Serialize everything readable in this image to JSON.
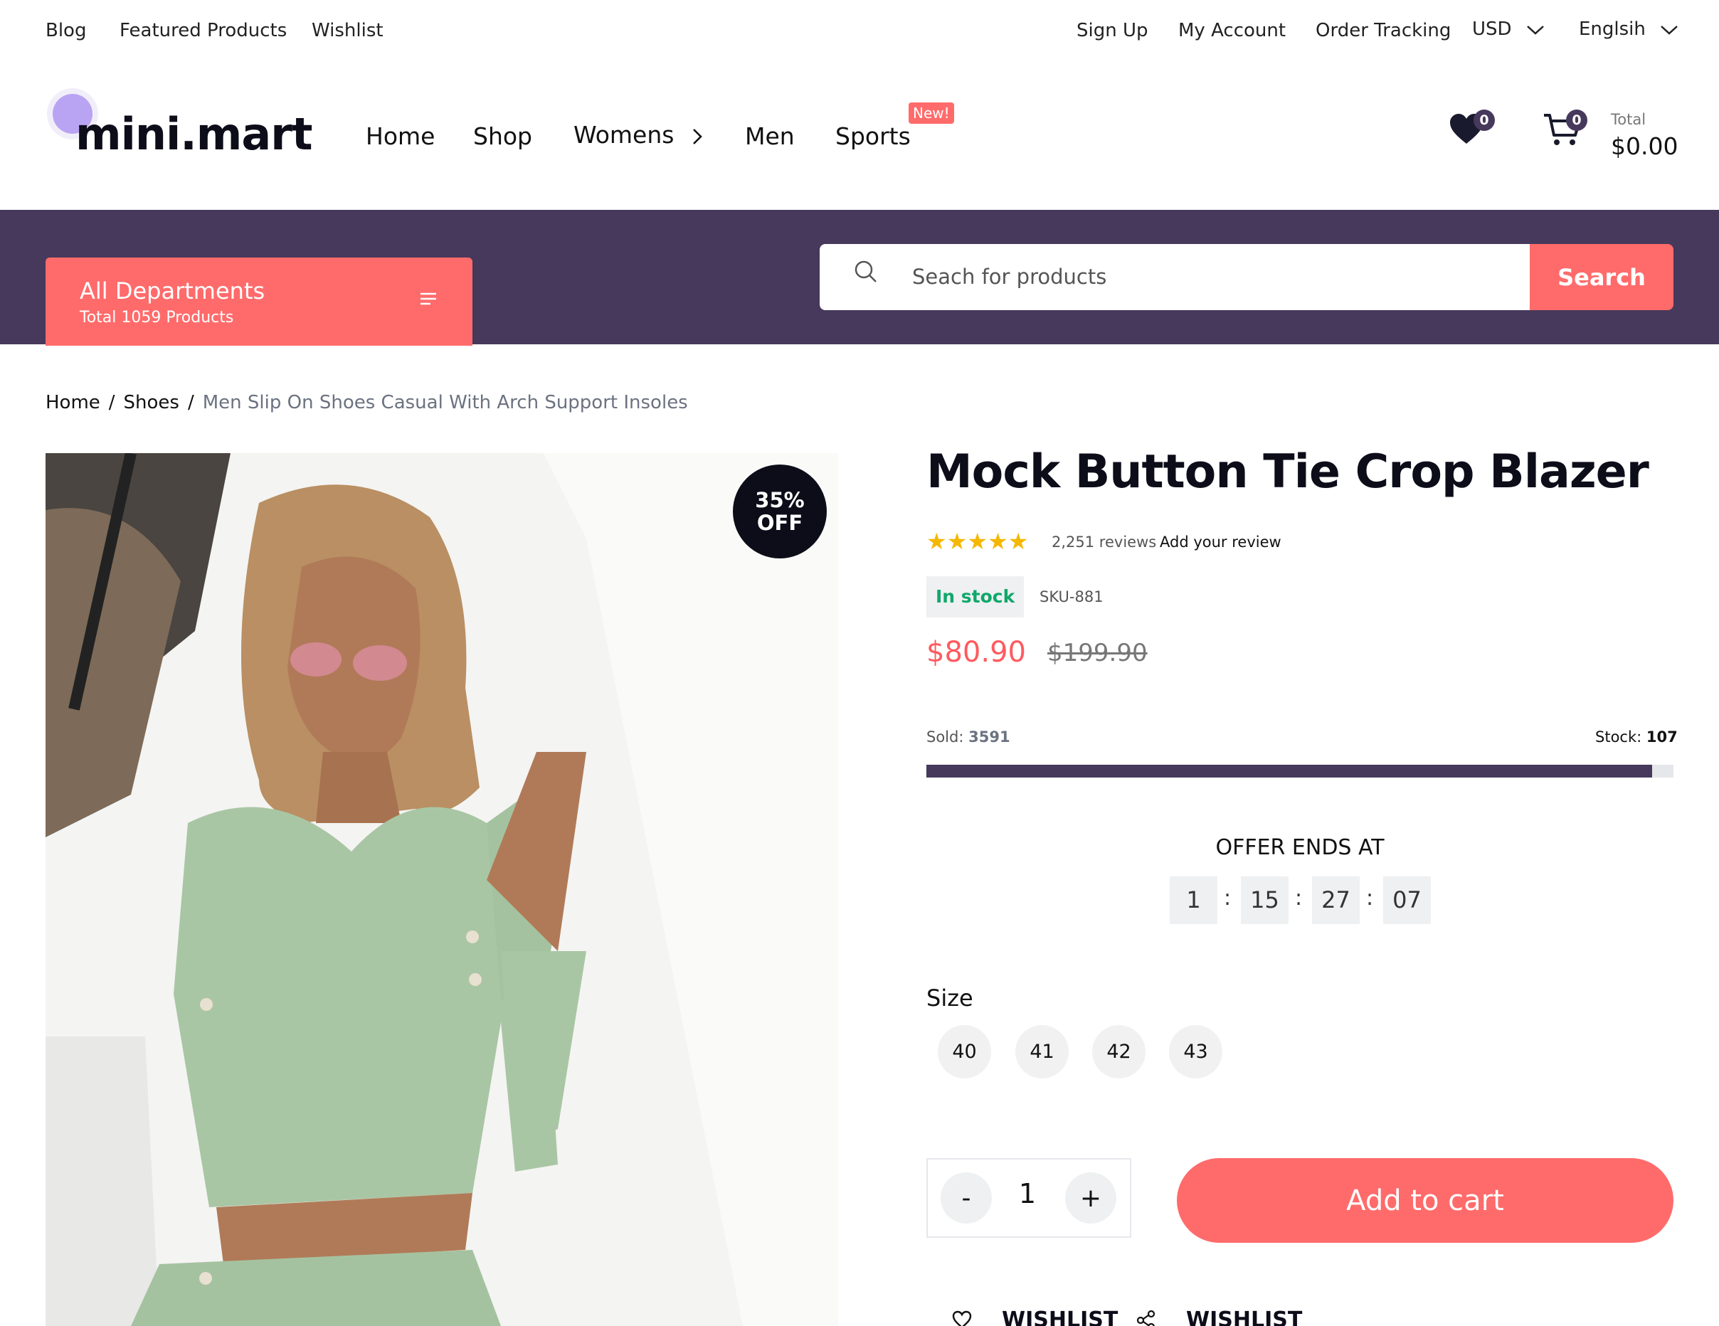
{
  "topbar": {
    "left_links": [
      "Blog",
      "Featured Products",
      "Wishlist"
    ],
    "right_links": [
      "Sign Up",
      "My Account",
      "Order Tracking"
    ],
    "currency": "USD",
    "language": "Englsih"
  },
  "header": {
    "logo": "mini.mart",
    "nav": [
      "Home",
      "Shop",
      "Womens",
      "Men",
      "Sports"
    ],
    "new_badge": "New!",
    "wishlist_count": "0",
    "cart_count": "0",
    "total_label": "Total",
    "total_value": "$0.00"
  },
  "departments": {
    "title": "All Departments",
    "subtitle": "Total 1059 Products"
  },
  "search": {
    "placeholder": "Seach for products",
    "button": "Search"
  },
  "breadcrumb": [
    "Home",
    "Shoes",
    "Men Slip On Shoes Casual With Arch Support Insoles"
  ],
  "product": {
    "badge_line1": "35%",
    "badge_line2": "OFF",
    "title": "Mock Button Tie Crop Blazer",
    "rating": 5,
    "stars": "★★★★★",
    "reviews": "2,251 reviews",
    "add_review": "Add your review",
    "stock_status": "In stock",
    "sku": "SKU-881",
    "price": "$80.90",
    "old_price": "$199.90",
    "sold_label": "Sold:",
    "sold_value": "3591",
    "stock_label": "Stock:",
    "stock_value": "107",
    "sold_fraction": 0.9711,
    "offer_label": "OFFER ENDS AT",
    "countdown": [
      "1",
      "15",
      "27",
      "07"
    ],
    "size_label": "Size",
    "sizes": [
      "40",
      "41",
      "42",
      "43"
    ],
    "quantity": "1",
    "minus": "-",
    "plus": "+",
    "add_to_cart": "Add to cart",
    "wishlist_label": "WISHLIST",
    "share_label": "WISHLIST"
  },
  "colors": {
    "accent": "#ff6b6b",
    "band": "#46395c",
    "in_stock": "#10a76b",
    "price": "#ff5a5f"
  }
}
